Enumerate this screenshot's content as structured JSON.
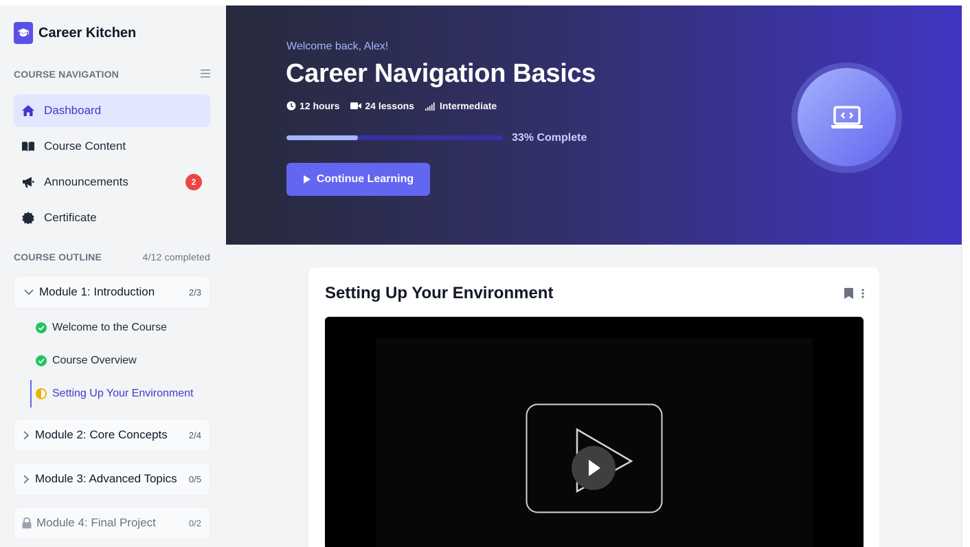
{
  "app": {
    "name": "Career Kitchen",
    "icon": "graduation-cap-icon"
  },
  "sidebar": {
    "nav_heading": "COURSE NAVIGATION",
    "nav_items": [
      {
        "label": "Dashboard",
        "icon": "home-icon",
        "active": true
      },
      {
        "label": "Course Content",
        "icon": "book-icon"
      },
      {
        "label": "Announcements",
        "icon": "megaphone-icon",
        "badge": "2"
      },
      {
        "label": "Certificate",
        "icon": "certificate-icon"
      }
    ],
    "outline_heading": "COURSE OUTLINE",
    "outline_progress": "4/12 completed",
    "modules": [
      {
        "title": "Module 1: Introduction",
        "count": "2/3",
        "expanded": true
      },
      {
        "title": "Module 2: Core Concepts",
        "count": "2/4"
      },
      {
        "title": "Module 3: Advanced Topics",
        "count": "0/5"
      },
      {
        "title": "Module 4: Final Project",
        "count": "0/2",
        "locked": true
      }
    ],
    "lessons": [
      {
        "title": "Welcome to the Course",
        "status": "complete"
      },
      {
        "title": "Course Overview",
        "status": "complete"
      },
      {
        "title": "Setting Up Your Environment",
        "status": "in-progress"
      }
    ]
  },
  "hero": {
    "welcome": "Welcome back, Alex!",
    "title": "Career Navigation Basics",
    "meta": {
      "duration": "12 hours",
      "lessons": "24 lessons",
      "level": "Intermediate"
    },
    "progress_percent": 33,
    "progress_label": "33% Complete",
    "cta_label": "Continue Learning"
  },
  "lesson_card": {
    "title": "Setting Up Your Environment"
  },
  "colors": {
    "accent": "#6366f1",
    "accent_dark": "#4338ca",
    "badge": "#ef4444",
    "complete": "#22c55e",
    "in_progress": "#eab308"
  }
}
